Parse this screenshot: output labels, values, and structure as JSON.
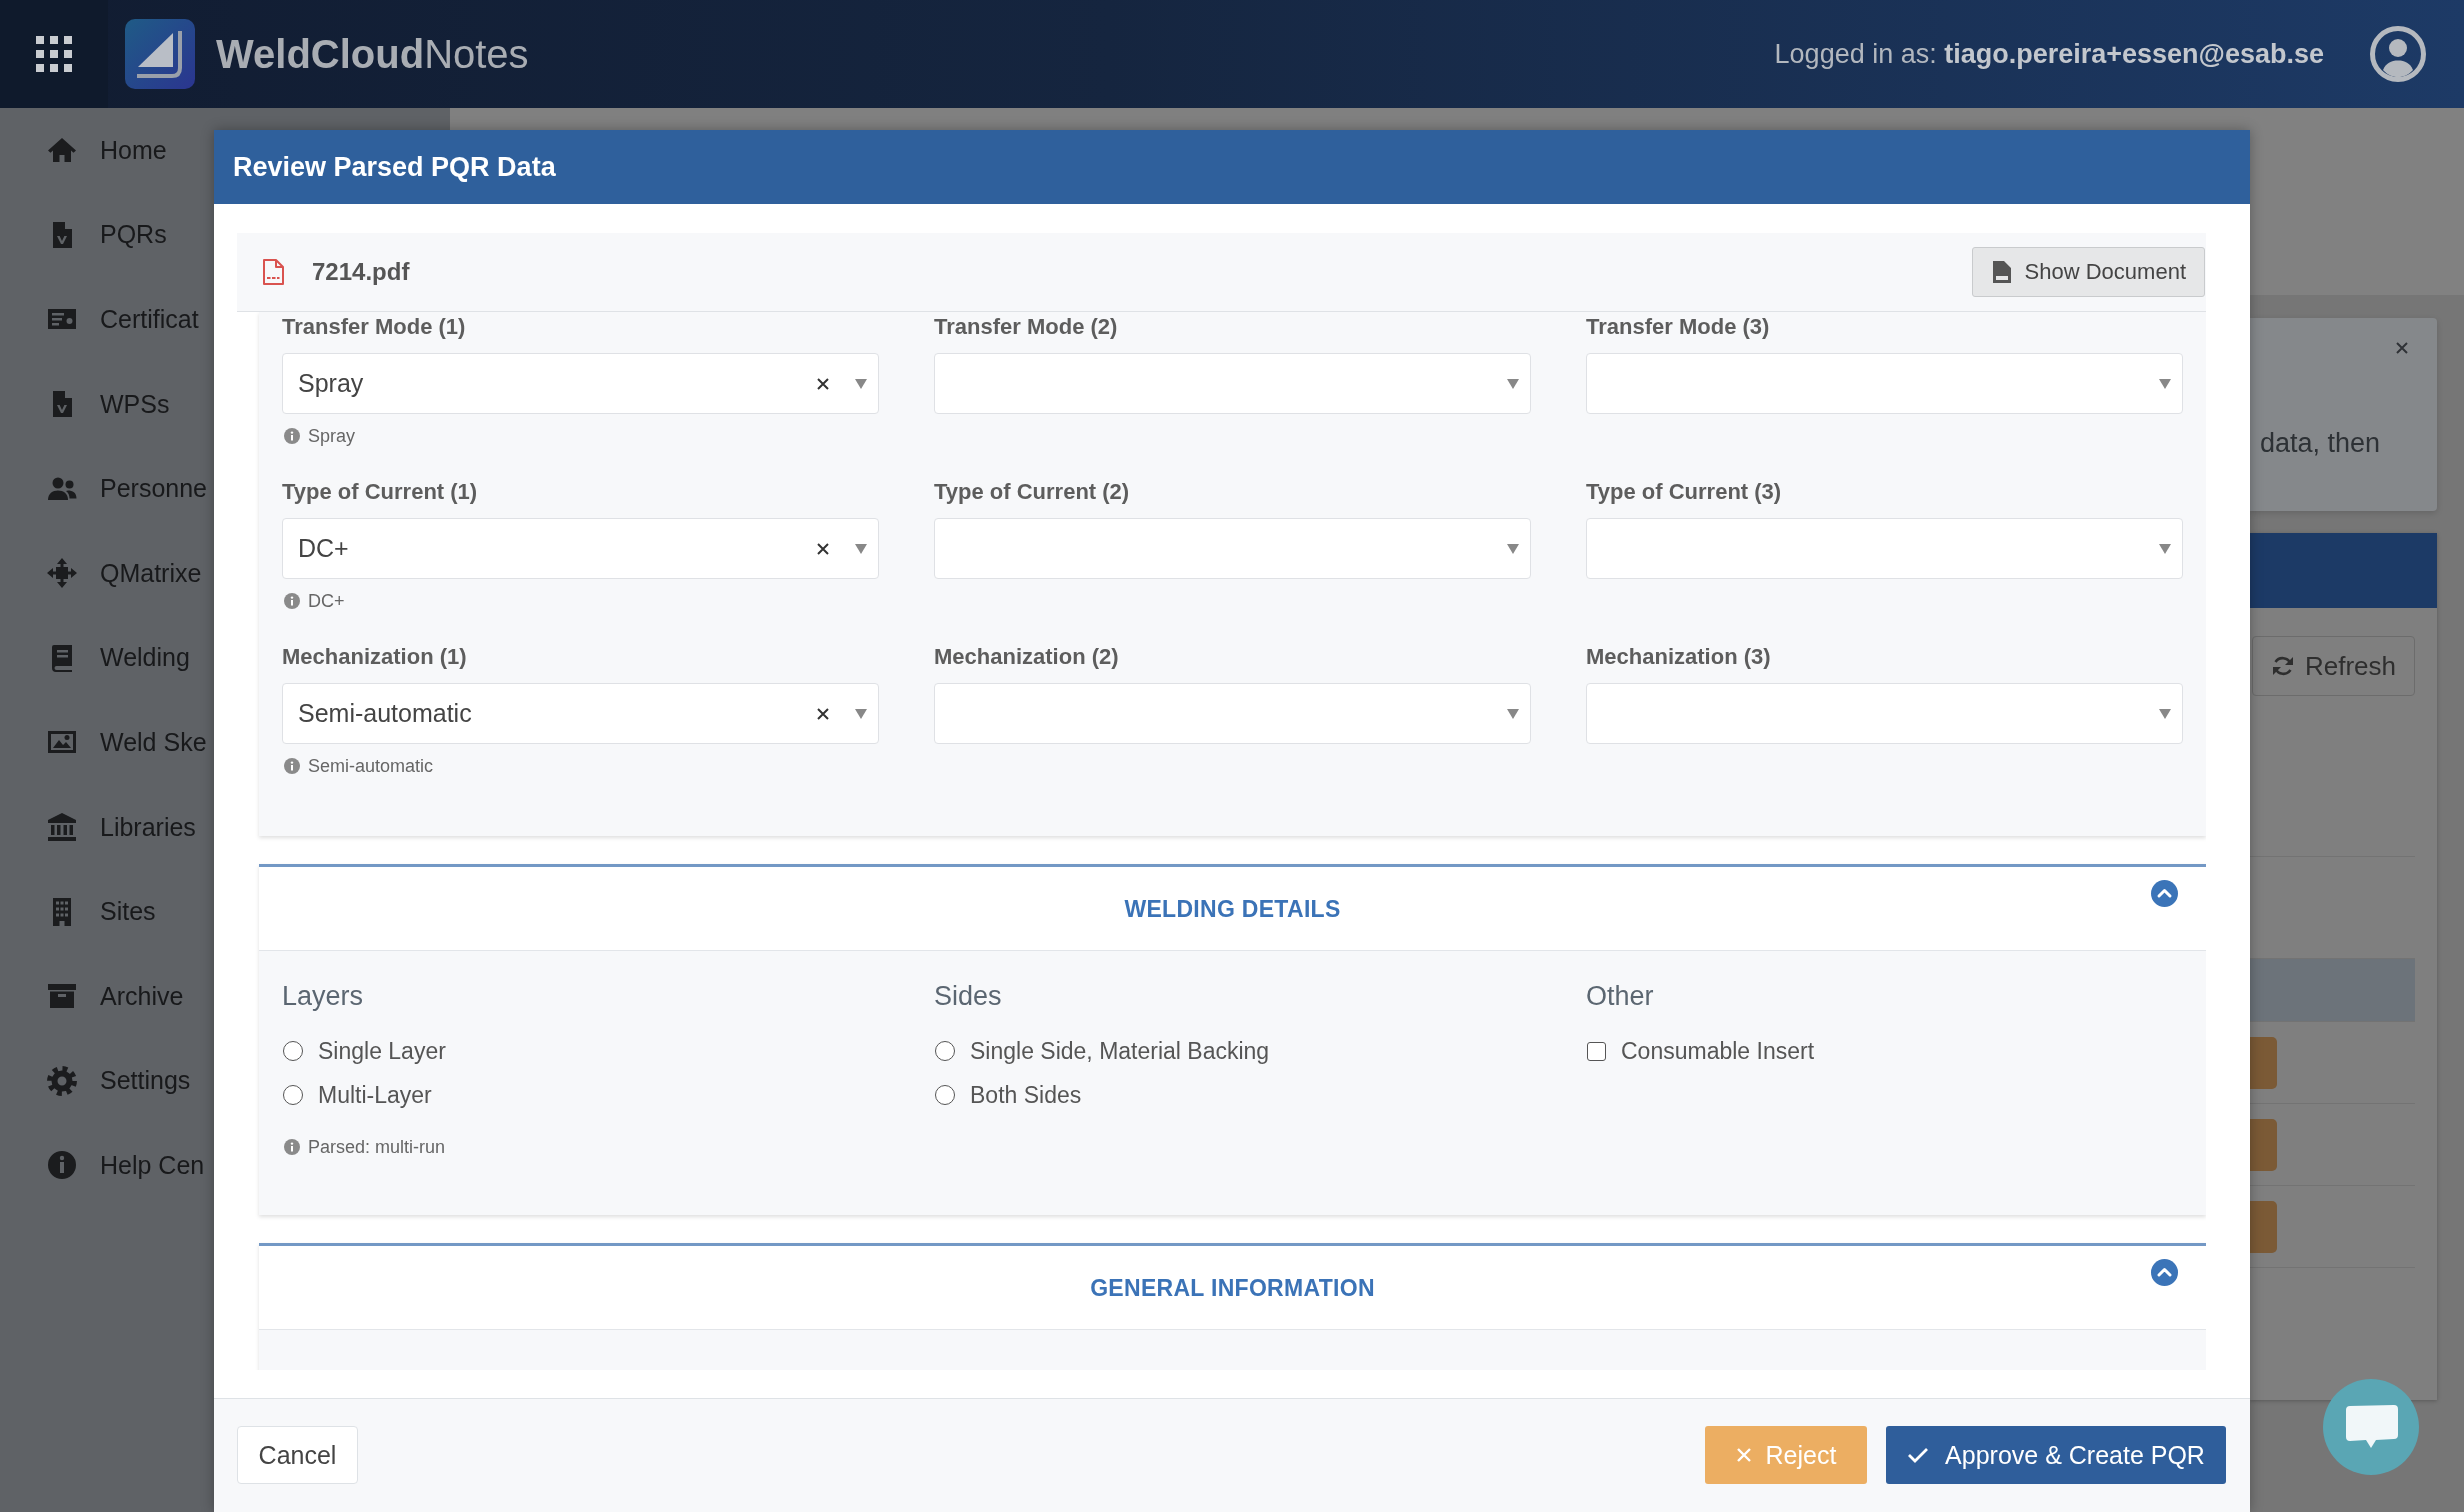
{
  "app_bar": {
    "brand": "**WeldCloud**Notes",
    "account": "Logged in as: **tiago.pereira+essen@esab.se**"
  },
  "sidebar": {
    "items": [
      {
        "label": "Home"
      },
      {
        "label": "PQRs"
      },
      {
        "label": "Certificat"
      },
      {
        "label": "WPSs"
      },
      {
        "label": "Personne"
      },
      {
        "label": "QMatrixe"
      },
      {
        "label": "Welding"
      },
      {
        "label": "Weld Ske"
      },
      {
        "label": "Libraries"
      },
      {
        "label": "Sites"
      },
      {
        "label": "Archive"
      },
      {
        "label": "Settings"
      },
      {
        "label": "Help Cen"
      }
    ]
  },
  "background_page": {
    "notice_text": "data, then",
    "refresh_button": "Refresh",
    "table_rows": [
      {
        "kind": "header",
        "selected": false
      },
      {
        "kind": "plain",
        "selected": true
      },
      {
        "kind": "action",
        "selected": false
      },
      {
        "kind": "action",
        "selected": false
      },
      {
        "kind": "action",
        "selected": false
      }
    ]
  },
  "dialog": {
    "title": "Review Parsed PQR Data",
    "file_name": "7214.pdf",
    "show_document_button": "Show Document",
    "field_rows": [
      {
        "fields": [
          {
            "label": "Transfer Mode (1)",
            "value": "Spray",
            "hint": "Spray"
          },
          {
            "label": "Transfer Mode (2)"
          },
          {
            "label": "Transfer Mode (3)"
          }
        ]
      },
      {
        "fields": [
          {
            "label": "Type of Current (1)",
            "value": "DC+",
            "hint": "DC+"
          },
          {
            "label": "Type of Current (2)"
          },
          {
            "label": "Type of Current (3)"
          }
        ]
      },
      {
        "fields": [
          {
            "label": "Mechanization (1)",
            "value": "Semi-automatic",
            "hint": "Semi-automatic"
          },
          {
            "label": "Mechanization (2)"
          },
          {
            "label": "Mechanization (3)"
          }
        ]
      }
    ],
    "sections": [
      {
        "title": "WELDING DETAILS",
        "expanded": true,
        "groups": [
          {
            "heading": "Layers",
            "kind": "radio",
            "options": [
              {
                "label": "Single Layer",
                "selected": false
              },
              {
                "label": "Multi-Layer",
                "selected": false
              }
            ],
            "hint": "Parsed: multi-run"
          },
          {
            "heading": "Sides",
            "kind": "radio",
            "options": [
              {
                "label": "Single Side, Material Backing",
                "selected": false
              },
              {
                "label": "Both Sides",
                "selected": false
              }
            ]
          },
          {
            "heading": "Other",
            "kind": "checkbox",
            "options": [
              {
                "label": "Consumable Insert",
                "checked": false
              }
            ]
          }
        ]
      },
      {
        "title": "GENERAL INFORMATION",
        "expanded": true
      }
    ],
    "buttons": {
      "cancel": "Cancel",
      "reject": "Reject",
      "approve": "Approve & Create PQR"
    }
  }
}
